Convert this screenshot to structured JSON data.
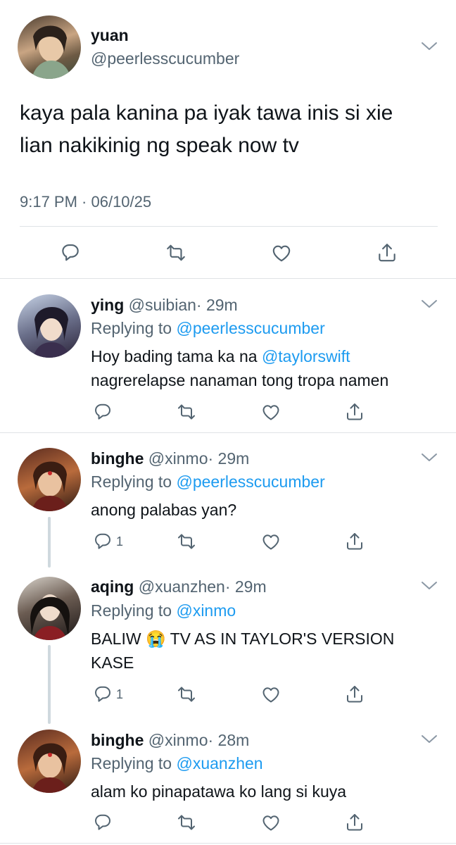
{
  "main_tweet": {
    "name": "yuan",
    "handle": "@peerlesscucumber",
    "text": "kaya pala kanina pa iyak tawa inis si xie lian nakikinig ng speak now tv",
    "timestamp": "9:17 PM · 06/10/25"
  },
  "replies": [
    {
      "name": "ying",
      "handle": "@suibian",
      "time": "· 29m",
      "replying_prefix": "Replying to",
      "replying_to": "@peerlesscucumber",
      "text_before": "Hoy bading tama ka na",
      "mention": "@taylorswift",
      "text_after": "nagrerelapse nanaman tong tropa namen"
    },
    {
      "name": "binghe",
      "handle": "@xinmo",
      "time": "· 29m",
      "replying_prefix": "Replying to",
      "replying_to": "@peerlesscucumber",
      "text": "anong palabas yan?",
      "reply_count": "1"
    },
    {
      "name": "aqing",
      "handle": "@xuanzhen",
      "time": "· 29m",
      "replying_prefix": "Replying to",
      "replying_to": "@xinmo",
      "text_before": "BALIW",
      "emoji": "😭",
      "text_after": "TV AS IN TAYLOR'S VERSION",
      "text_line2": "KASE",
      "reply_count": "1"
    },
    {
      "name": "binghe",
      "handle": "@xinmo",
      "time": "· 28m",
      "replying_prefix": "Replying to",
      "replying_to": "@xuanzhen",
      "text": "alam ko pinapatawa ko lang si kuya"
    }
  ],
  "icons": {
    "reply": "reply-icon",
    "retweet": "retweet-icon",
    "like": "heart-icon",
    "share": "share-icon",
    "more": "chevron-down-icon"
  },
  "colors": {
    "link": "#1d9bf0",
    "muted": "#536471",
    "text": "#0f1419",
    "divider": "#dfe3e6"
  }
}
